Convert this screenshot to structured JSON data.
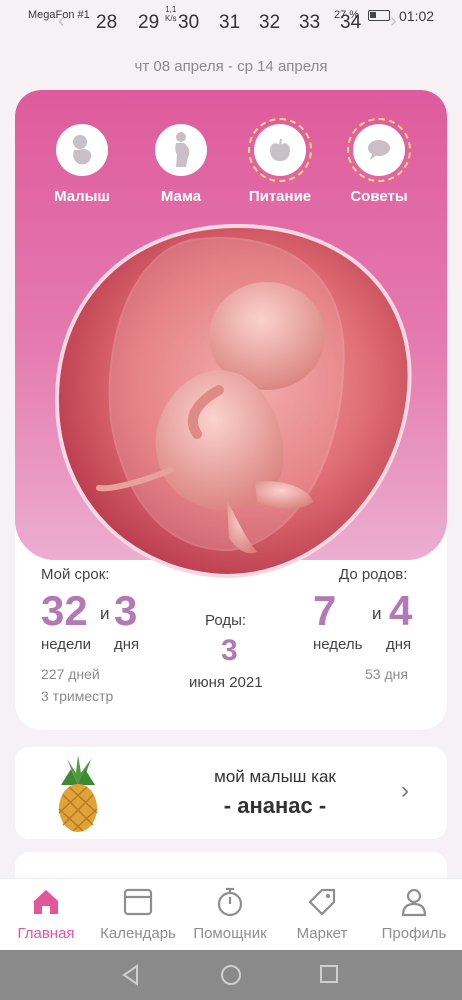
{
  "status": {
    "carrier": "MegaFon #1",
    "speed": "1,1\nK/s",
    "battery": "27 %",
    "time": "01:02"
  },
  "week": {
    "days": [
      "28",
      "29",
      "30",
      "31",
      "32",
      "33",
      "34"
    ],
    "range": "чт 08 апреля - ср 14 апреля"
  },
  "categories": [
    {
      "label": "Малыш",
      "icon": "baby-icon"
    },
    {
      "label": "Мама",
      "icon": "mother-icon"
    },
    {
      "label": "Питание",
      "icon": "apple-icon"
    },
    {
      "label": "Советы",
      "icon": "chat-bubble-icon"
    }
  ],
  "term": {
    "title": "Мой срок:",
    "weeks": "32",
    "and": "и",
    "days": "3",
    "weeks_label": "недели",
    "days_label": "дня",
    "total_days": "227 дней",
    "trimester": "3 триместр"
  },
  "birth": {
    "title": "Роды:",
    "day": "3",
    "month_year": "июня 2021"
  },
  "remaining": {
    "title": "До родов:",
    "weeks": "7",
    "and": "и",
    "days": "4",
    "weeks_label": "недель",
    "days_label": "дня",
    "total_days": "53 дня"
  },
  "fruit": {
    "caption": "мой малыш как",
    "name": "- ананас -"
  },
  "nav": [
    {
      "label": "Главная",
      "icon": "home-icon",
      "active": true
    },
    {
      "label": "Календарь",
      "icon": "calendar-icon"
    },
    {
      "label": "Помощник",
      "icon": "stopwatch-icon"
    },
    {
      "label": "Маркет",
      "icon": "tag-icon"
    },
    {
      "label": "Профиль",
      "icon": "profile-icon"
    }
  ],
  "colors": {
    "accent": "#e4559a",
    "number": "#b279b4",
    "ring": "#ffd77a"
  }
}
